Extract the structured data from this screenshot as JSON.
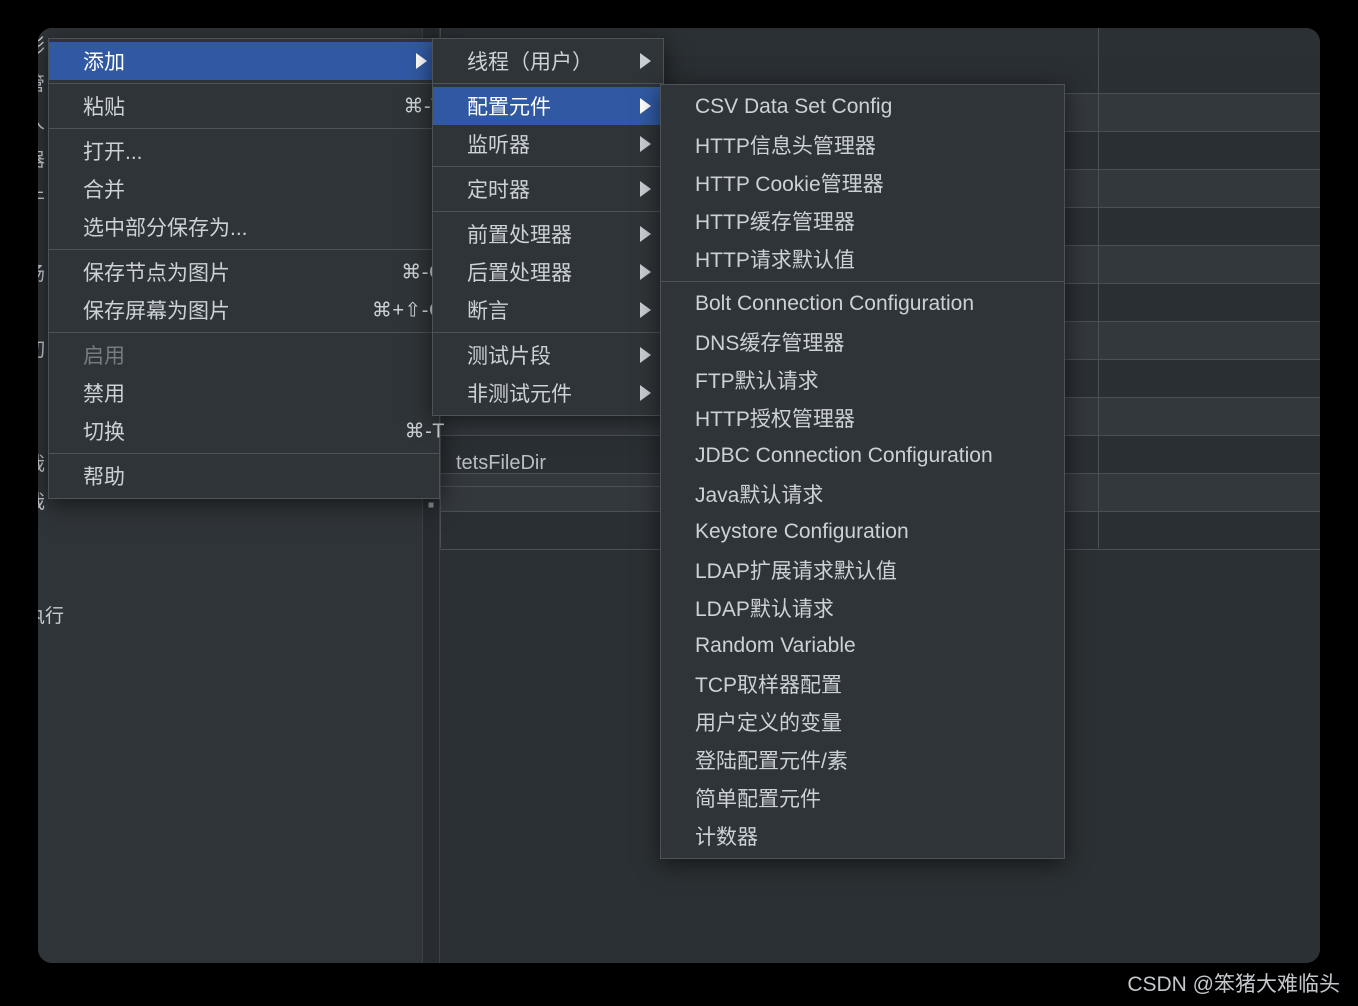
{
  "window": {
    "background_color": "#2b3034",
    "accent_color": "#3159a3",
    "text_color": "#ccd1d6"
  },
  "background": {
    "tree_rows": [
      {
        "text": "影"
      },
      {
        "text": "管"
      },
      {
        "text": "人 ("
      },
      {
        "text": "器"
      },
      {
        "text": "牛"
      },
      {
        "text": ""
      },
      {
        "text": "汤"
      },
      {
        "text": ""
      },
      {
        "text": "切"
      },
      {
        "text": ") "
      },
      {
        "text": ""
      },
      {
        "text": "哉"
      },
      {
        "text": "哉"
      },
      {
        "text": ""
      },
      {
        "text": ""
      },
      {
        "text": "执行"
      },
      {
        "text": ""
      },
      {
        "text": ""
      },
      {
        "text": ""
      }
    ],
    "field_label": "tetsFileDir"
  },
  "context_menu": {
    "name": "节点右键菜单",
    "items": [
      {
        "label": "添加",
        "shortcut": "",
        "submenu": true,
        "selected": true,
        "disabled": false
      },
      {
        "separator": true
      },
      {
        "label": "粘贴",
        "shortcut": "⌘-V",
        "submenu": false,
        "selected": false,
        "disabled": false
      },
      {
        "separator": true
      },
      {
        "label": "打开...",
        "shortcut": "",
        "submenu": false,
        "selected": false,
        "disabled": false
      },
      {
        "label": "合并",
        "shortcut": "",
        "submenu": false,
        "selected": false,
        "disabled": false
      },
      {
        "label": "选中部分保存为...",
        "shortcut": "",
        "submenu": false,
        "selected": false,
        "disabled": false
      },
      {
        "separator": true
      },
      {
        "label": "保存节点为图片",
        "shortcut": "⌘-G",
        "submenu": false,
        "selected": false,
        "disabled": false
      },
      {
        "label": "保存屏幕为图片",
        "shortcut": "⌘+⇧-G",
        "submenu": false,
        "selected": false,
        "disabled": false
      },
      {
        "separator": true
      },
      {
        "label": "启用",
        "shortcut": "",
        "submenu": false,
        "selected": false,
        "disabled": true
      },
      {
        "label": "禁用",
        "shortcut": "",
        "submenu": false,
        "selected": false,
        "disabled": false
      },
      {
        "label": "切换",
        "shortcut": "⌘-T",
        "submenu": false,
        "selected": false,
        "disabled": false
      },
      {
        "separator": true
      },
      {
        "label": "帮助",
        "shortcut": "",
        "submenu": false,
        "selected": false,
        "disabled": false
      }
    ]
  },
  "add_submenu": {
    "name": "添加子菜单",
    "items": [
      {
        "label": "线程（用户）",
        "submenu": true,
        "selected": false
      },
      {
        "separator": true
      },
      {
        "label": "配置元件",
        "submenu": true,
        "selected": true
      },
      {
        "label": "监听器",
        "submenu": true,
        "selected": false
      },
      {
        "separator": true
      },
      {
        "label": "定时器",
        "submenu": true,
        "selected": false
      },
      {
        "separator": true
      },
      {
        "label": "前置处理器",
        "submenu": true,
        "selected": false
      },
      {
        "label": "后置处理器",
        "submenu": true,
        "selected": false
      },
      {
        "label": "断言",
        "submenu": true,
        "selected": false
      },
      {
        "separator": true
      },
      {
        "label": "测试片段",
        "submenu": true,
        "selected": false
      },
      {
        "label": "非测试元件",
        "submenu": true,
        "selected": false
      }
    ]
  },
  "config_submenu": {
    "name": "配置元件子菜单",
    "items": [
      {
        "label": "CSV Data Set Config"
      },
      {
        "label": "HTTP信息头管理器"
      },
      {
        "label": "HTTP Cookie管理器"
      },
      {
        "label": "HTTP缓存管理器"
      },
      {
        "label": "HTTP请求默认值"
      },
      {
        "separator": true
      },
      {
        "label": "Bolt Connection Configuration"
      },
      {
        "label": "DNS缓存管理器"
      },
      {
        "label": "FTP默认请求"
      },
      {
        "label": "HTTP授权管理器"
      },
      {
        "label": "JDBC Connection Configuration"
      },
      {
        "label": "Java默认请求"
      },
      {
        "label": "Keystore Configuration"
      },
      {
        "label": "LDAP扩展请求默认值"
      },
      {
        "label": "LDAP默认请求"
      },
      {
        "label": "Random Variable"
      },
      {
        "label": "TCP取样器配置"
      },
      {
        "label": "用户定义的变量"
      },
      {
        "label": "登陆配置元件/素"
      },
      {
        "label": "简单配置元件"
      },
      {
        "label": "计数器"
      }
    ]
  },
  "watermark": {
    "text": "CSDN @笨猪大难临头"
  }
}
